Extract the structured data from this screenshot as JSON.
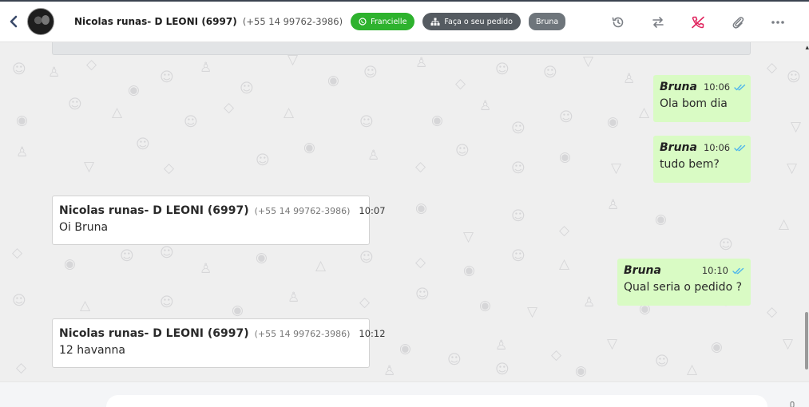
{
  "header": {
    "contact_name": "Nicolas runas- D LEONI (6997)",
    "contact_phone": "(+55 14 99762-3986)",
    "tags": [
      {
        "label": "Francielle",
        "icon": "whatsapp-icon",
        "color": "#2eb22e"
      },
      {
        "label": "Faça o seu pedido",
        "icon": "sitemap-icon",
        "color": "#555b61"
      },
      {
        "label": "Bruna",
        "color": "#6e757b"
      }
    ],
    "actions": [
      "history-icon",
      "transfer-icon",
      "end-call-icon",
      "attach-icon",
      "more-icon"
    ]
  },
  "messages": [
    {
      "direction": "out",
      "sender": "Bruna",
      "time": "10:06",
      "text": "Ola bom dia",
      "read": true
    },
    {
      "direction": "out",
      "sender": "Bruna",
      "time": "10:06",
      "text": "tudo bem?",
      "read": true
    },
    {
      "direction": "in",
      "sender": "Nicolas runas- D LEONI (6997)",
      "phone": "(+55 14 99762-3986)",
      "time": "10:07",
      "text": "Oi Bruna"
    },
    {
      "direction": "out",
      "sender": "Bruna",
      "time": "10:10",
      "text": "Qual seria o pedido ?",
      "read": true
    },
    {
      "direction": "in",
      "sender": "Nicolas runas- D LEONI (6997)",
      "phone": "(+55 14 99762-3986)",
      "time": "10:12",
      "text": "12 havanna"
    }
  ],
  "colors": {
    "outgoing_bubble": "#d9fbc4",
    "incoming_bubble": "#ffffff",
    "read_ticks": "#4fb6ec",
    "end_call": "#e0245e"
  }
}
